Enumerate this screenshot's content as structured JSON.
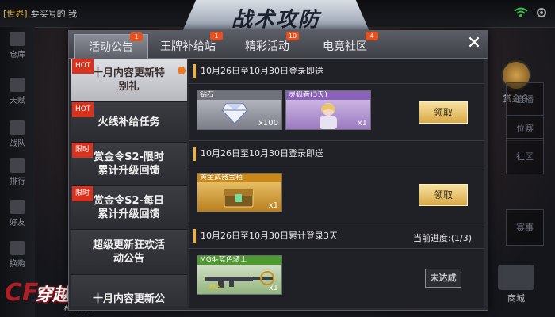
{
  "top": {
    "chat_tag": "[世界]",
    "chat_text": "要买号的 我",
    "banner_title": "战术攻防"
  },
  "left_rail": [
    "仓库",
    "天赋",
    "战队",
    "排行",
    "好友",
    "换购"
  ],
  "right_rail": {
    "shop_label": "赏金令",
    "boxes": [
      "直播",
      "位赛",
      "社区",
      "赛事"
    ],
    "mall_label": "商城"
  },
  "logo": {
    "main": "穿越火线",
    "sub": "枪战王者"
  },
  "tabs": [
    {
      "label": "活动公告",
      "badge": "1",
      "active": true
    },
    {
      "label": "王牌补给站",
      "badge": "1",
      "active": false
    },
    {
      "label": "精彩活动",
      "badge": "10",
      "active": false
    },
    {
      "label": "电竞社区",
      "badge": "4",
      "active": false
    }
  ],
  "close_glyph": "✕",
  "list_items": [
    {
      "label": "十月内容更新特别礼",
      "hot": "HOT",
      "dot": true,
      "selected": true
    },
    {
      "label": "火线补给任务",
      "hot": "HOT",
      "dot": false,
      "selected": false
    },
    {
      "label": "赏金令S2-限时累计升级回馈",
      "hot": "限时",
      "dot": false,
      "selected": false
    },
    {
      "label": "赏金令S2-每日累计升级回馈",
      "hot": "限时",
      "dot": false,
      "selected": false
    },
    {
      "label": "超级更新狂欢活动公告",
      "hot": "",
      "dot": false,
      "selected": false
    },
    {
      "label": "十月内容更新公",
      "hot": "",
      "dot": false,
      "selected": false
    }
  ],
  "sections": [
    {
      "title": "10月26日至10月30日登录即送",
      "items": [
        {
          "name": "钻石",
          "qty": "x100",
          "rarity": "gray",
          "icon": "diamond-icon"
        },
        {
          "name": "灵狐者(3天)",
          "qty": "x1",
          "rarity": "purple",
          "icon": "character-icon"
        }
      ],
      "action": "领取",
      "action_type": "button"
    },
    {
      "title": "10月26日至10月30日登录即送",
      "items": [
        {
          "name": "黄金武器宝箱",
          "qty": "x1",
          "rarity": "gold",
          "icon": "chest-icon"
        }
      ],
      "action": "领取",
      "action_type": "button"
    },
    {
      "title": "10月26日至10月30日累计登录3天",
      "progress": "当前进度:(1/3)",
      "items": [
        {
          "name": "MG4-蓝色骑士",
          "qty": "x1",
          "rarity": "green",
          "icon": "rifle-icon"
        }
      ],
      "action": "未达成",
      "action_type": "status"
    }
  ],
  "colors": {
    "accent_gold": "#f0b335",
    "badge_orange": "#e8501f",
    "hot_red": "#d8321f"
  }
}
